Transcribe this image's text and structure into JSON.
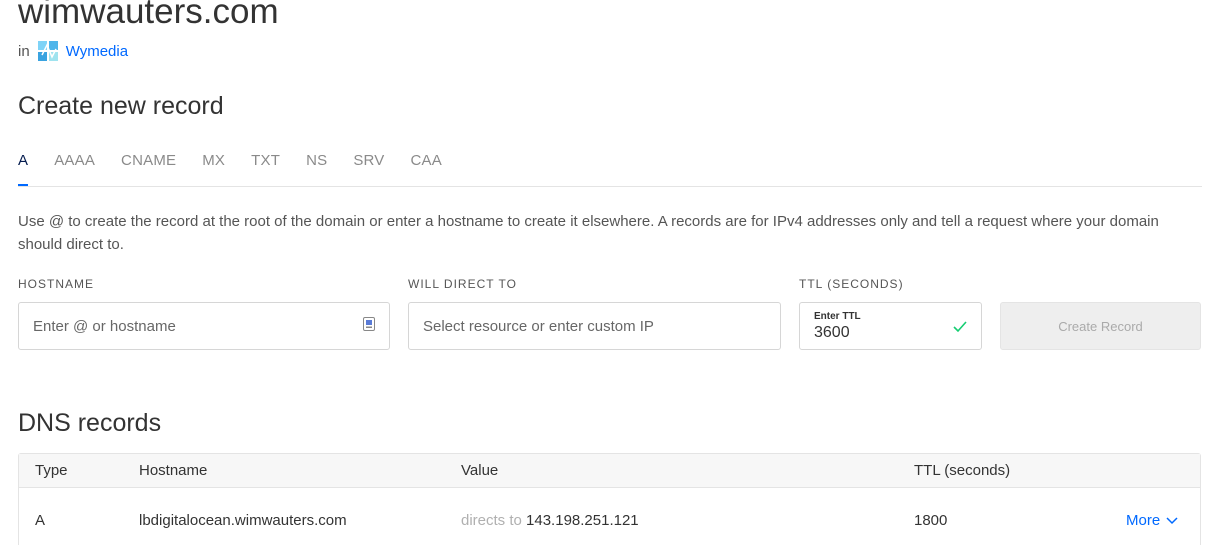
{
  "domain": {
    "title": "wimwauters.com",
    "in_label": "in",
    "project_name": "Wymedia",
    "project_icon": "project-logo-icon"
  },
  "create_record": {
    "title": "Create new record",
    "tabs": [
      {
        "label": "A",
        "active": true
      },
      {
        "label": "AAAA",
        "active": false
      },
      {
        "label": "CNAME",
        "active": false
      },
      {
        "label": "MX",
        "active": false
      },
      {
        "label": "TXT",
        "active": false
      },
      {
        "label": "NS",
        "active": false
      },
      {
        "label": "SRV",
        "active": false
      },
      {
        "label": "CAA",
        "active": false
      }
    ],
    "help_text": "Use @ to create the record at the root of the domain or enter a hostname to create it elsewhere. A records are for IPv4 addresses only and tell a request where your domain should direct to.",
    "hostname": {
      "label": "HOSTNAME",
      "placeholder": "Enter @ or hostname",
      "icon": "contact-card-icon"
    },
    "direct_to": {
      "label": "WILL DIRECT TO",
      "placeholder": "Select resource or enter custom IP"
    },
    "ttl": {
      "label": "TTL (SECONDS)",
      "sublabel": "Enter TTL",
      "value": "3600",
      "icon": "check-icon"
    },
    "submit_label": "Create Record"
  },
  "dns_records": {
    "title": "DNS records",
    "columns": [
      "Type",
      "Hostname",
      "Value",
      "TTL (seconds)"
    ],
    "rows": [
      {
        "type": "A",
        "hostname": "lbdigitalocean.wimwauters.com",
        "value_prefix": "directs to",
        "value": "143.198.251.121",
        "ttl": "1800",
        "action": "More"
      }
    ]
  },
  "colors": {
    "accent": "#0069ff",
    "active_tab_text": "#031b4e",
    "success": "#15cd72",
    "disabled_button_bg": "#eeeeee"
  }
}
